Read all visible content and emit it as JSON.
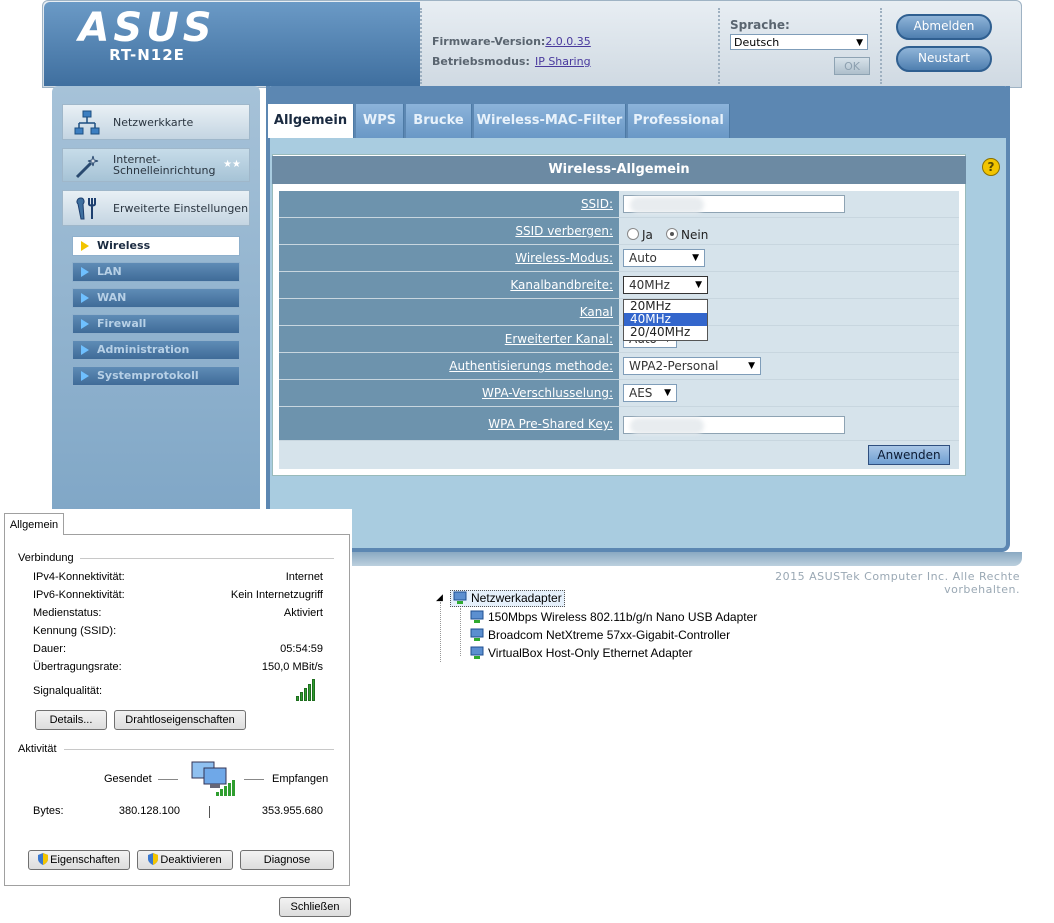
{
  "router": {
    "logo": "ASUS",
    "model": "RT-N12E",
    "firmware_label": "Firmware-Version:",
    "firmware_value": "2.0.0.35",
    "mode_label": "Betriebsmodus:",
    "mode_value": "IP Sharing",
    "language_label": "Sprache:",
    "language_value": "Deutsch",
    "ok_label": "OK",
    "logout_label": "Abmelden",
    "restart_label": "Neustart",
    "nav": {
      "network_map": "Netzwerkkarte",
      "quick_setup": "Internet-\nSchnelleinrichtung",
      "advanced": "Erweiterte Einstellungen",
      "sub": [
        "Wireless",
        "LAN",
        "WAN",
        "Firewall",
        "Administration",
        "Systemprotokoll"
      ]
    },
    "tabs": [
      "Allgemein",
      "WPS",
      "Brucke",
      "Wireless-MAC-Filter",
      "Professional"
    ],
    "help_icon": "?",
    "form_title": "Wireless-Allgemein",
    "rows": [
      {
        "label": "SSID:"
      },
      {
        "label": "SSID verbergen:",
        "opt_yes": "Ja",
        "opt_no": "Nein"
      },
      {
        "label": "Wireless-Modus:",
        "value": "Auto"
      },
      {
        "label": "Kanalbandbreite:",
        "value": "40MHz"
      },
      {
        "label": "Kanal"
      },
      {
        "label": "Erweiterter Kanal:",
        "value": "Auto"
      },
      {
        "label": "Authentisierungs methode:",
        "value": "WPA2-Personal"
      },
      {
        "label": "WPA-Verschlusselung:",
        "value": "AES"
      },
      {
        "label": "WPA Pre-Shared Key:"
      }
    ],
    "bandwidth_options": [
      "20MHz",
      "40MHz",
      "20/40MHz"
    ],
    "apply_label": "Anwenden",
    "copyright": "2015 ASUSTek Computer Inc. Alle Rechte vorbehalten."
  },
  "dialog": {
    "tab": "Allgemein",
    "connection_group": "Verbindung",
    "ipv4_label": "IPv4-Konnektivität:",
    "ipv4_value": "Internet",
    "ipv6_label": "IPv6-Konnektivität:",
    "ipv6_value": "Kein Internetzugriff",
    "media_label": "Medienstatus:",
    "media_value": "Aktiviert",
    "ssid_label": "Kennung (SSID):",
    "duration_label": "Dauer:",
    "duration_value": "05:54:59",
    "rate_label": "Übertragungsrate:",
    "rate_value": "150,0 MBit/s",
    "signal_label": "Signalqualität:",
    "details_btn": "Details...",
    "wireless_props_btn": "Drahtloseigenschaften",
    "activity_group": "Aktivität",
    "sent_label": "Gesendet",
    "received_label": "Empfangen",
    "bytes_label": "Bytes:",
    "bytes_sent": "380.128.100",
    "bytes_received": "353.955.680",
    "properties_btn": "Eigenschaften",
    "disable_btn": "Deaktivieren",
    "diagnose_btn": "Diagnose",
    "close_btn": "Schließen"
  },
  "devices": {
    "root": "Netzwerkadapter",
    "items": [
      "150Mbps Wireless 802.11b/g/n Nano USB Adapter",
      "Broadcom NetXtreme 57xx-Gigabit-Controller",
      "VirtualBox Host-Only Ethernet Adapter"
    ]
  }
}
